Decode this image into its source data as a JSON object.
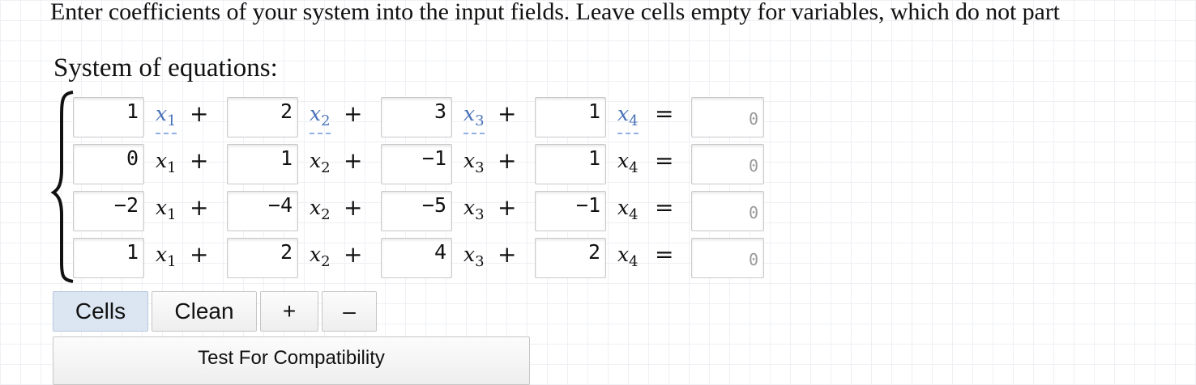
{
  "instructions": "Enter coefficients of your system into the input fields. Leave cells empty for variables, which do not part",
  "system_label": "System of equations:",
  "variables": [
    "x",
    "x",
    "x",
    "x"
  ],
  "subscripts": [
    "1",
    "2",
    "3",
    "4"
  ],
  "plus": "+",
  "equals": "=",
  "rows": [
    {
      "coeffs": [
        "1",
        "2",
        "3",
        "1"
      ],
      "rhs_placeholder": "0"
    },
    {
      "coeffs": [
        "0",
        "1",
        "−1",
        "1"
      ],
      "rhs_placeholder": "0"
    },
    {
      "coeffs": [
        "−2",
        "−4",
        "−5",
        "−1"
      ],
      "rhs_placeholder": "0"
    },
    {
      "coeffs": [
        "1",
        "2",
        "4",
        "2"
      ],
      "rhs_placeholder": "0"
    }
  ],
  "buttons": {
    "cells": "Cells",
    "clean": "Clean",
    "add": "+",
    "remove": "–",
    "test": "Test For Compatibility"
  },
  "colors": {
    "variable_highlight": "#4a72b8",
    "active_button": "#dbe6f2"
  }
}
